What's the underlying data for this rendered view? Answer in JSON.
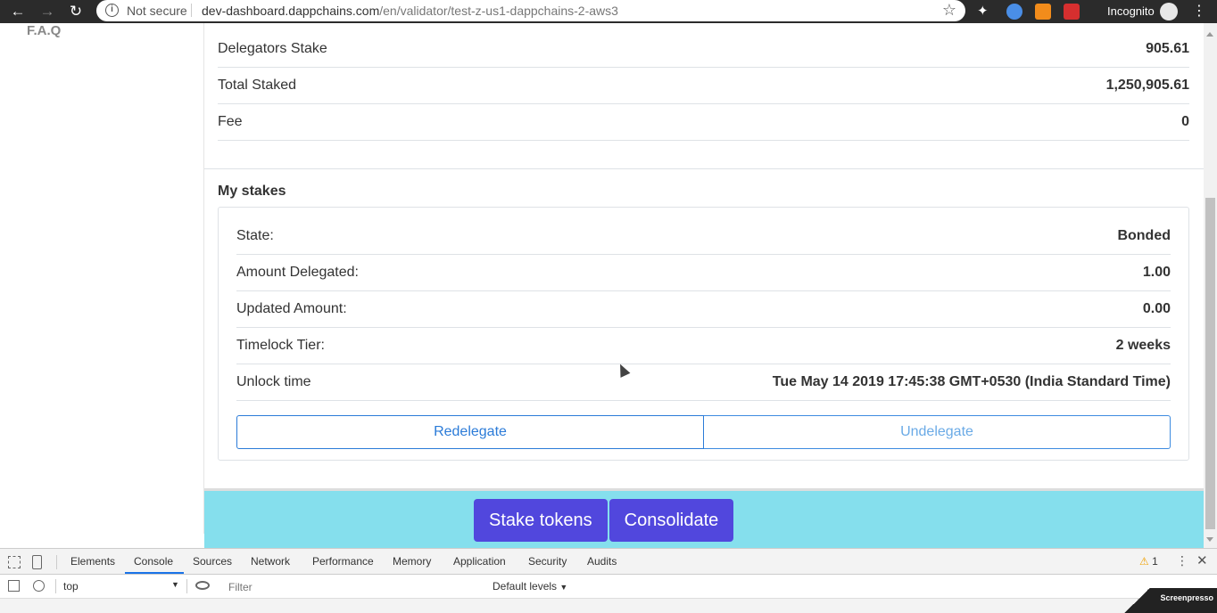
{
  "browser": {
    "security_label": "Not secure",
    "url_host": "dev-dashboard.dappchains.com",
    "url_path": "/en/validator/test-z-us1-dappchains-2-aws3",
    "incognito_label": "Incognito"
  },
  "sidebar": {
    "faq_label": "F.A.Q"
  },
  "validator": {
    "rows": [
      {
        "label": "Delegators Stake",
        "value": "905.61"
      },
      {
        "label": "Total Staked",
        "value": "1,250,905.61"
      },
      {
        "label": "Fee",
        "value": "0"
      }
    ]
  },
  "my_stakes": {
    "title": "My stakes",
    "rows": [
      {
        "label": "State:",
        "value": "Bonded"
      },
      {
        "label": "Amount Delegated:",
        "value": "1.00"
      },
      {
        "label": "Updated Amount:",
        "value": "0.00"
      },
      {
        "label": "Timelock Tier:",
        "value": "2 weeks"
      },
      {
        "label": "Unlock time",
        "value": "Tue May 14 2019 17:45:38 GMT+0530 (India Standard Time)"
      }
    ],
    "redelegate_label": "Redelegate",
    "undelegate_label": "Undelegate"
  },
  "footer": {
    "stake_label": "Stake tokens",
    "consolidate_label": "Consolidate"
  },
  "devtools": {
    "tabs": [
      "Elements",
      "Console",
      "Sources",
      "Network",
      "Performance",
      "Memory",
      "Application",
      "Security",
      "Audits"
    ],
    "active_tab": "Console",
    "warning_count": "1",
    "context": "top",
    "filter_placeholder": "Filter",
    "levels_label": "Default levels"
  },
  "watermark": "Screenpresso"
}
